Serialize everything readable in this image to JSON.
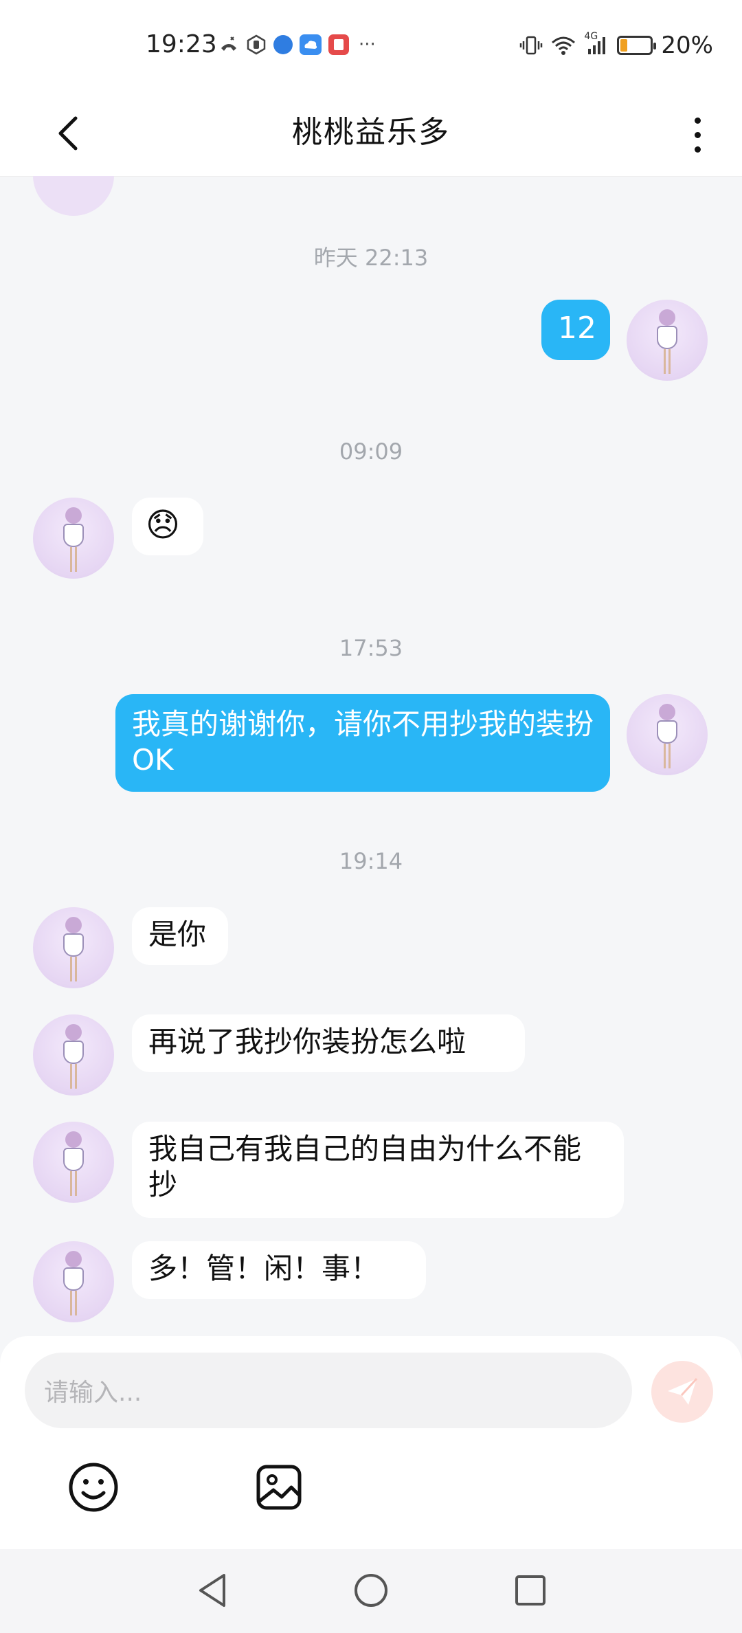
{
  "status_bar": {
    "time": "19:23",
    "battery_percent": "20%",
    "network": "4G",
    "battery_level": 0.2,
    "notification_icons": [
      "missed-call-icon",
      "hand-icon",
      "app-blue-icon",
      "cloud-icon",
      "app-red-icon"
    ],
    "more": "···"
  },
  "header": {
    "title": "桃桃益乐多"
  },
  "messages": [
    {
      "type": "timestamp",
      "text": "昨天 22:13"
    },
    {
      "type": "outgoing",
      "text": "12"
    },
    {
      "type": "timestamp",
      "text": "09:09"
    },
    {
      "type": "incoming",
      "text": "😞"
    },
    {
      "type": "timestamp",
      "text": "17:53"
    },
    {
      "type": "outgoing",
      "text": "我真的谢谢你，请你不用抄我的装扮OK"
    },
    {
      "type": "timestamp",
      "text": "19:14"
    },
    {
      "type": "incoming",
      "text": "是你"
    },
    {
      "type": "incoming",
      "text": "再说了我抄你装扮怎么啦"
    },
    {
      "type": "incoming",
      "text": "我自己有我自己的自由为什么不能抄"
    },
    {
      "type": "incoming",
      "text": "多！管！闲！事！"
    }
  ],
  "composer": {
    "placeholder": "请输入..."
  },
  "colors": {
    "outgoing_bubble": "#29b6f6",
    "incoming_bubble": "#ffffff",
    "background": "#f5f6f8",
    "send_button": "#fde3df"
  }
}
